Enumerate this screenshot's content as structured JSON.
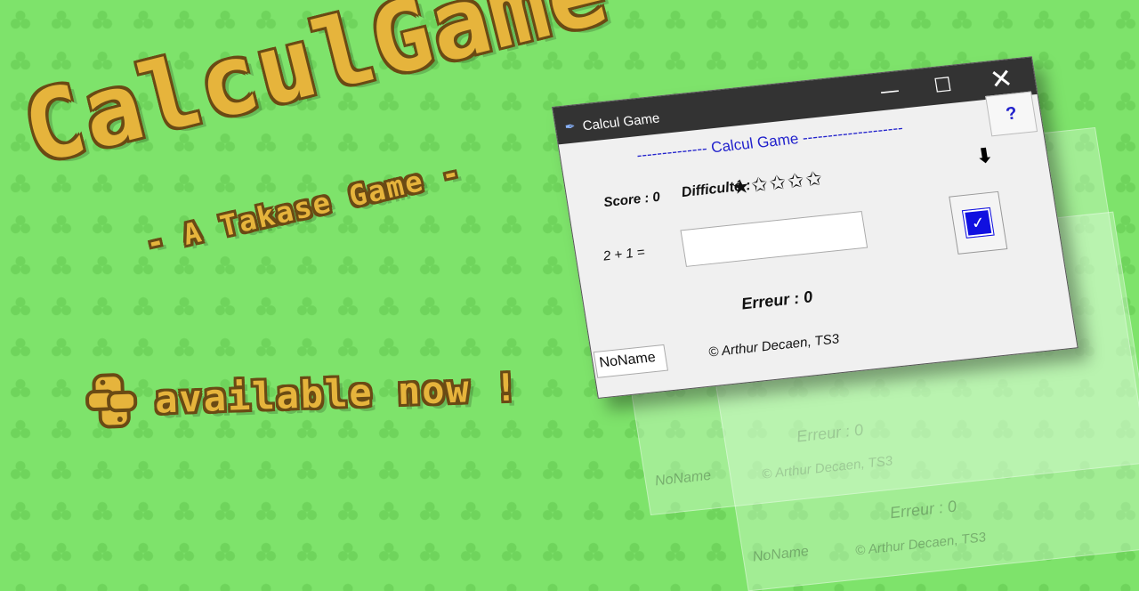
{
  "banner": {
    "title": "CalculGame",
    "subtitle": "- A Takase Game -",
    "available": "available now !"
  },
  "window": {
    "title": "Calcul Game",
    "controls": {
      "minimize": "—",
      "maximize": "☐",
      "close": "✕"
    },
    "header": "-------------- Calcul Game --------------------",
    "help_label": "?",
    "score": "Score : 0",
    "difficulty": "Difficulté :",
    "stars": "★✩✩✩✩",
    "arrow": "⬇",
    "question": "2 + 1 =",
    "answer_value": "",
    "check_label": "✓",
    "errors": "Erreur : 0",
    "name_value": "NoName",
    "copyright": "© Arthur Decaen, TS3"
  },
  "ghosts": {
    "errors": "Erreur : 0",
    "name": "NoName",
    "copyright": "© Arthur Decaen, TS3"
  },
  "colors": {
    "background": "#7ee36b",
    "logo_fill": "#e6b43c",
    "logo_outline": "#6a4a14",
    "accent_blue": "#2222cc"
  },
  "icons": {
    "logo": "python-logo-icon",
    "app": "feather-icon"
  }
}
